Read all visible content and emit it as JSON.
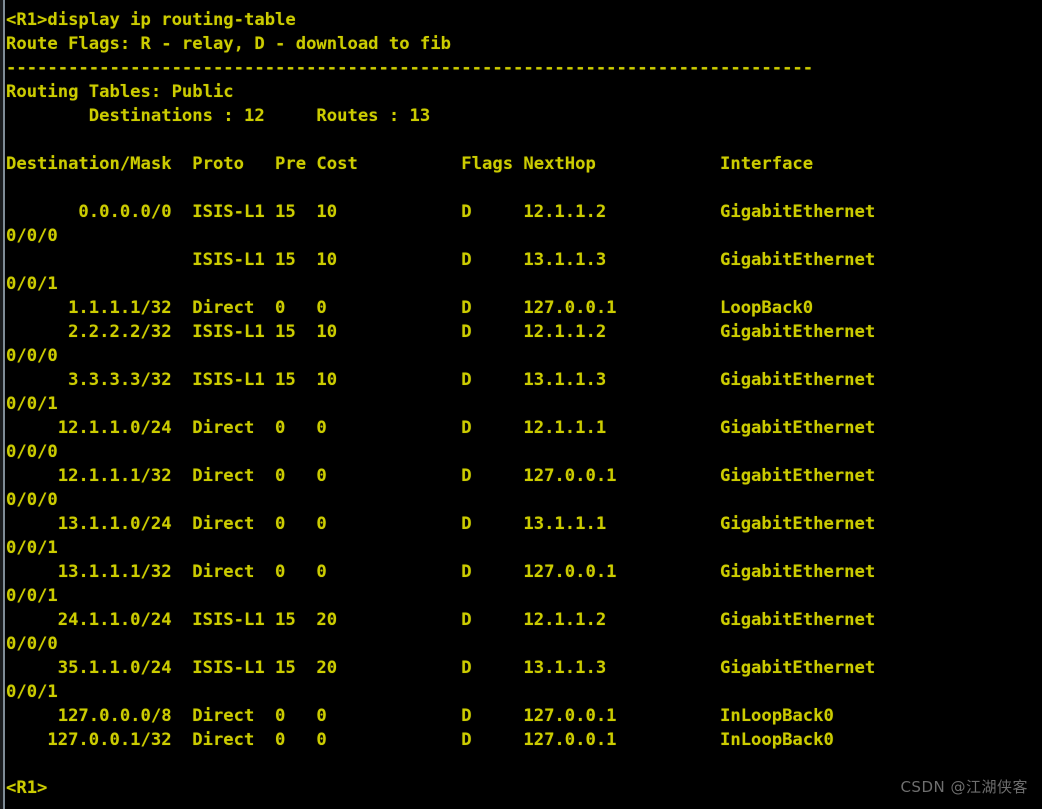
{
  "terminal": {
    "background_color": "#000000",
    "text_color": "#cccc00",
    "prompt": "<R1>",
    "command": "display ip routing-table",
    "flags_legend": "Route Flags: R - relay, D - download to fib",
    "separator": "------------------------------------------------------------------------------",
    "table_scope_label": "Routing Tables: Public",
    "summary": {
      "destinations_label": "Destinations",
      "destinations_count": "12",
      "routes_label": "Routes",
      "routes_count": "13"
    },
    "columns": {
      "destination_mask": "Destination/Mask",
      "proto": "Proto",
      "pre": "Pre",
      "cost": "Cost",
      "flags": "Flags",
      "nexthop": "NextHop",
      "interface": "Interface"
    },
    "rows": [
      {
        "destination": "0.0.0.0/0",
        "proto": "ISIS-L1",
        "pre": "15",
        "cost": "10",
        "flags": "D",
        "nexthop": "12.1.1.2",
        "interface": "GigabitEthernet",
        "interface_wrap": "0/0/0"
      },
      {
        "destination": "",
        "proto": "ISIS-L1",
        "pre": "15",
        "cost": "10",
        "flags": "D",
        "nexthop": "13.1.1.3",
        "interface": "GigabitEthernet",
        "interface_wrap": "0/0/1"
      },
      {
        "destination": "1.1.1.1/32",
        "proto": "Direct",
        "pre": "0",
        "cost": "0",
        "flags": "D",
        "nexthop": "127.0.0.1",
        "interface": "LoopBack0",
        "interface_wrap": ""
      },
      {
        "destination": "2.2.2.2/32",
        "proto": "ISIS-L1",
        "pre": "15",
        "cost": "10",
        "flags": "D",
        "nexthop": "12.1.1.2",
        "interface": "GigabitEthernet",
        "interface_wrap": "0/0/0"
      },
      {
        "destination": "3.3.3.3/32",
        "proto": "ISIS-L1",
        "pre": "15",
        "cost": "10",
        "flags": "D",
        "nexthop": "13.1.1.3",
        "interface": "GigabitEthernet",
        "interface_wrap": "0/0/1"
      },
      {
        "destination": "12.1.1.0/24",
        "proto": "Direct",
        "pre": "0",
        "cost": "0",
        "flags": "D",
        "nexthop": "12.1.1.1",
        "interface": "GigabitEthernet",
        "interface_wrap": "0/0/0"
      },
      {
        "destination": "12.1.1.1/32",
        "proto": "Direct",
        "pre": "0",
        "cost": "0",
        "flags": "D",
        "nexthop": "127.0.0.1",
        "interface": "GigabitEthernet",
        "interface_wrap": "0/0/0"
      },
      {
        "destination": "13.1.1.0/24",
        "proto": "Direct",
        "pre": "0",
        "cost": "0",
        "flags": "D",
        "nexthop": "13.1.1.1",
        "interface": "GigabitEthernet",
        "interface_wrap": "0/0/1"
      },
      {
        "destination": "13.1.1.1/32",
        "proto": "Direct",
        "pre": "0",
        "cost": "0",
        "flags": "D",
        "nexthop": "127.0.0.1",
        "interface": "GigabitEthernet",
        "interface_wrap": "0/0/1"
      },
      {
        "destination": "24.1.1.0/24",
        "proto": "ISIS-L1",
        "pre": "15",
        "cost": "20",
        "flags": "D",
        "nexthop": "12.1.1.2",
        "interface": "GigabitEthernet",
        "interface_wrap": "0/0/0"
      },
      {
        "destination": "35.1.1.0/24",
        "proto": "ISIS-L1",
        "pre": "15",
        "cost": "20",
        "flags": "D",
        "nexthop": "13.1.1.3",
        "interface": "GigabitEthernet",
        "interface_wrap": "0/0/1"
      },
      {
        "destination": "127.0.0.0/8",
        "proto": "Direct",
        "pre": "0",
        "cost": "0",
        "flags": "D",
        "nexthop": "127.0.0.1",
        "interface": "InLoopBack0",
        "interface_wrap": ""
      },
      {
        "destination": "127.0.0.1/32",
        "proto": "Direct",
        "pre": "0",
        "cost": "0",
        "flags": "D",
        "nexthop": "127.0.0.1",
        "interface": "InLoopBack0",
        "interface_wrap": ""
      }
    ],
    "trailing_prompt": "<R1>"
  },
  "watermark": {
    "text": "CSDN @江湖侠客",
    "color": "#6e6e6e"
  }
}
